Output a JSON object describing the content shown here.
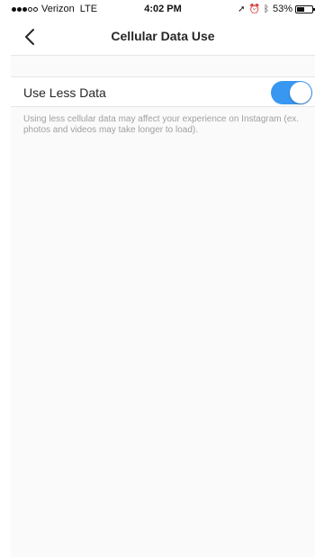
{
  "status_bar": {
    "carrier": "Verizon",
    "network": "LTE",
    "time": "4:02 PM",
    "battery_pct": "53%",
    "battery_level": 0.53,
    "signal_filled": 3,
    "signal_total": 5
  },
  "nav": {
    "title": "Cellular Data Use",
    "back_icon": "chevron-left-icon"
  },
  "setting": {
    "label": "Use Less Data",
    "toggle_on": true,
    "description": "Using less cellular data may affect your experience on Instagram (ex. photos and videos may take longer to load)."
  },
  "colors": {
    "accent": "#3897f0",
    "background": "#fafafa",
    "muted_text": "#a0a0a0"
  }
}
